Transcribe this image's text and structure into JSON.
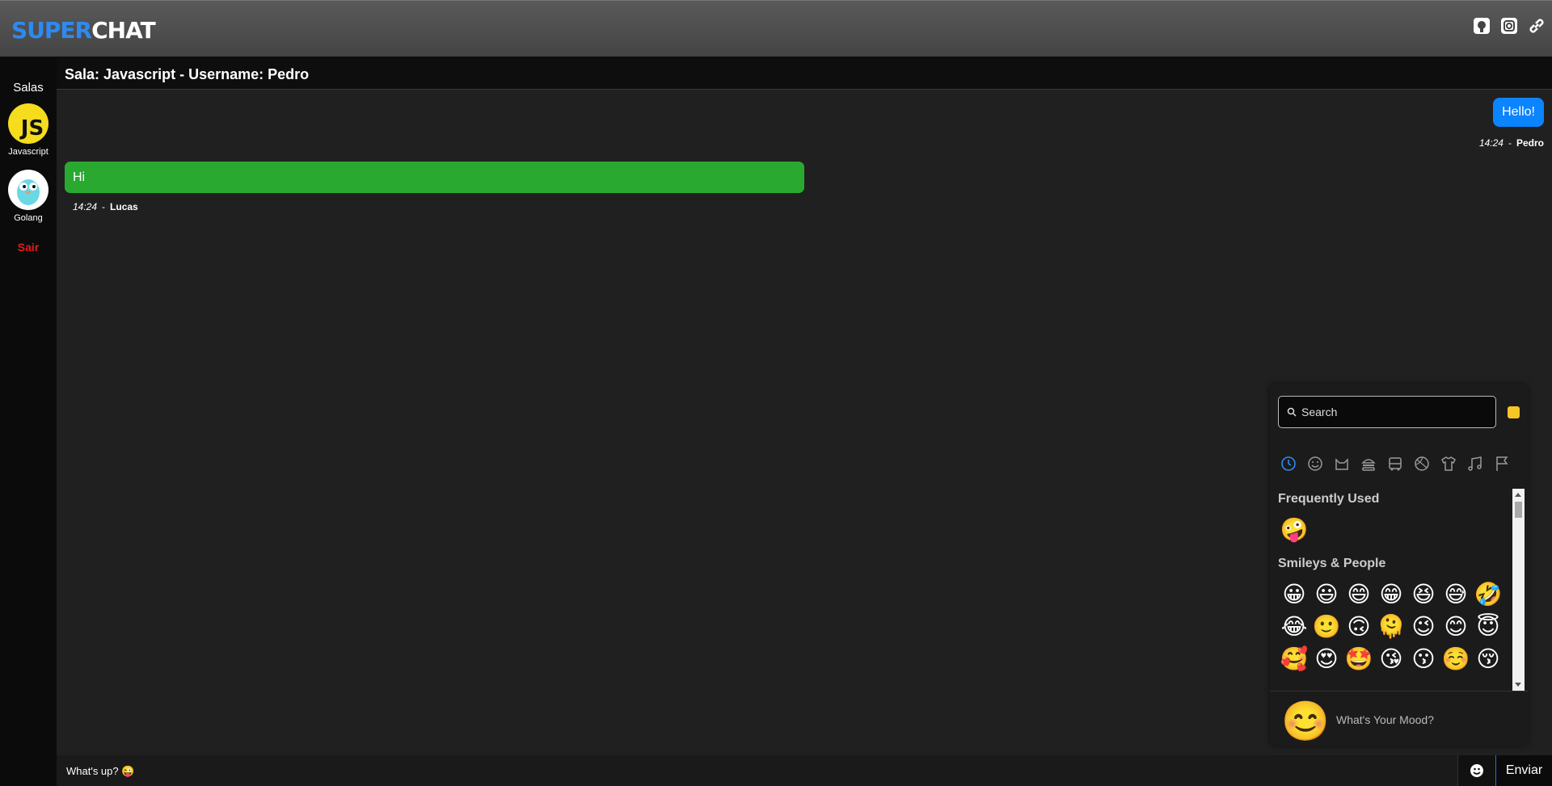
{
  "app": {
    "logo_part1": "SUPER",
    "logo_part2": "CHAT"
  },
  "header_icons": [
    "github-icon",
    "instagram-icon",
    "link-icon"
  ],
  "sidebar": {
    "title": "Salas",
    "rooms": [
      {
        "label": "Javascript",
        "avatar_text": "JS"
      },
      {
        "label": "Golang"
      }
    ],
    "exit_label": "Sair"
  },
  "room_header": {
    "title": "Sala: Javascript - Username: Pedro"
  },
  "messages": [
    {
      "text": "Hello!",
      "time": "14:24",
      "sep": "-",
      "user": "Pedro",
      "color": "#0b84ff"
    },
    {
      "text": "Hi",
      "time": "14:24",
      "sep": "-",
      "user": "Lucas",
      "color": "#29a92f"
    }
  ],
  "emoji_picker": {
    "search_placeholder": "Search",
    "categories": [
      "clock-icon",
      "smiley-icon",
      "cat-icon",
      "burger-icon",
      "bus-icon",
      "ball-icon",
      "shirt-icon",
      "music-icon",
      "flag-icon"
    ],
    "sections": [
      {
        "title": "Frequently Used",
        "emojis": [
          "🤪"
        ]
      },
      {
        "title": "Smileys & People",
        "emojis": [
          "😀",
          "😃",
          "😄",
          "😁",
          "😆",
          "😅",
          "🤣",
          "😂",
          "🙂",
          "🙃",
          "🫠",
          "😉",
          "😊",
          "😇",
          "🥰",
          "😍",
          "🤩",
          "😘",
          "😗",
          "☺️",
          "😚"
        ]
      }
    ],
    "preview_emoji": "😊",
    "preview_text": "What's Your Mood?",
    "skin_color": "#f7c623"
  },
  "composer": {
    "text": "What's up? 😜",
    "send_label": "Enviar"
  }
}
